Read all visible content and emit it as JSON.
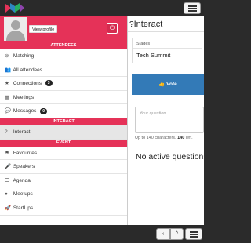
{
  "header": {
    "logo_icon": "app-logo-icon",
    "menu_icon": "hamburger-icon"
  },
  "profile": {
    "view_profile_label": "View profile",
    "power_icon": "power-icon"
  },
  "sections": {
    "attendees": "ATTENDEES",
    "interact": "INTERACT",
    "event": "EVENT"
  },
  "sidebar": {
    "matching": {
      "label": "Matching",
      "icon": "⊚"
    },
    "all_attendees": {
      "label": "All attendees",
      "icon": "👥"
    },
    "connections": {
      "label": "Connections",
      "icon": "★",
      "count": "3"
    },
    "meetings": {
      "label": "Meetings",
      "icon": "▦"
    },
    "messages": {
      "label": "Messages",
      "icon": "💬",
      "count": "0"
    },
    "interact": {
      "label": "Interact",
      "icon": "?"
    },
    "favourites": {
      "label": "Favourites",
      "icon": "⚑"
    },
    "speakers": {
      "label": "Speakers",
      "icon": "🎤"
    },
    "agenda": {
      "label": "Agenda",
      "icon": "☰"
    },
    "meetups": {
      "label": "Meetups",
      "icon": "●"
    },
    "startups": {
      "label": "StartUps",
      "icon": "🚀"
    }
  },
  "main": {
    "title_icon": "?",
    "title": "Interact",
    "stages_label": "Stages",
    "stage_value": "Tech Summit",
    "vote_icon": "👍",
    "vote_label": "Vote",
    "question_placeholder": "Your question",
    "counter_prefix": "Up to 140 characters.",
    "counter_value": "140",
    "counter_suffix": "left.",
    "no_active": "No active questions"
  },
  "bottom": {
    "back": "‹",
    "up": "^"
  },
  "colors": {
    "accent": "#e53258",
    "vote": "#337ab7",
    "bar": "#2a2a2a"
  }
}
